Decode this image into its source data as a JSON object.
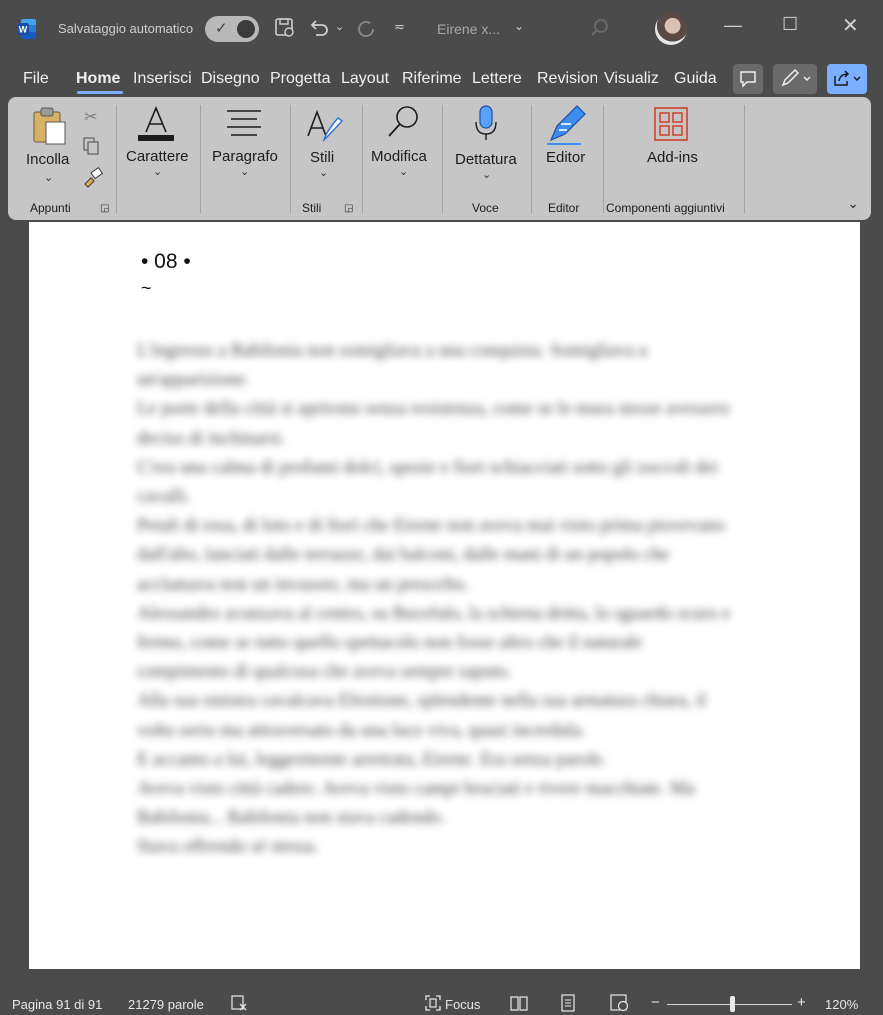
{
  "titlebar": {
    "app_icon": "word-icon",
    "app_letter": "W",
    "autosave_label": "Salvataggio automatico",
    "autosave_on": true,
    "document_name": "Eirene x...",
    "icons": [
      "save-sync-icon",
      "undo-icon",
      "redo-icon",
      "customize-qat-icon",
      "search-icon"
    ]
  },
  "menu": {
    "tabs": [
      "File",
      "Home",
      "Inserisci",
      "Disegno",
      "Progetta",
      "Layout",
      "Riferime",
      "Lettere",
      "Revision",
      "Visualiz",
      "Guida"
    ],
    "active_tab": "Home",
    "right_buttons": [
      "comments-icon",
      "editing-pen-icon",
      "share-icon"
    ]
  },
  "ribbon": {
    "incolla": "Incolla",
    "appunti": "Appunti",
    "carattere": "Carattere",
    "paragrafo": "Paragrafo",
    "stili": "Stili",
    "stili_group": "Stili",
    "modifica": "Modifica",
    "dettatura": "Dettatura",
    "voce": "Voce",
    "editor": "Editor",
    "editor_group": "Editor",
    "addins": "Add-ins",
    "componenti": "Componenti aggiuntivi"
  },
  "document": {
    "header_mark": "• 08 •",
    "tilde": "~",
    "paragraphs": [
      "L'ingresso a Babilonia non somigliava a una conquista. Somigliava a un'apparizione.",
      "Le porte della città si aprirono senza resistenza, come se le mura stesse avessero deciso di inchinarsi.",
      "C'era una calma di profumi dolci, spezie e fiori schiacciati sotto gli zoccoli dei cavalli.",
      "Petali di rosa, di loto e di fiori che Eirene non aveva mai visto prima piovevano dall'alto, lanciati dalle terrazze, dai balconi, dalle mani di un popolo che acclamava non un invasore, ma un prescelto.",
      "Alessandro avanzava al centro, su Bucefalo, la schiena dritta, lo sguardo scuro e fermo, come se tutto quello spettacolo non fosse altro che il naturale compimento di qualcosa che aveva sempre saputo.",
      "Alla sua sinistra cavalcava Efestione, splendente nella sua armatura chiara, il volto serio ma attraversato da una luce viva, quasi incredula.",
      "E accanto a lui, leggermente arretrata, Eirene. Era senza parole.",
      "Aveva visto città cadere. Aveva visto campi bruciati e rivere macchiate. Ma Babilonia... Babilonia non stava cadendo.",
      "Stava offrendo sé stessa."
    ]
  },
  "statusbar": {
    "page": "Pagina 91 di 91",
    "words": "21279 parole",
    "focus": "Focus",
    "zoom_minus": "−",
    "zoom_plus": "+",
    "zoom": "120%",
    "zoom_level_percent": 120
  }
}
